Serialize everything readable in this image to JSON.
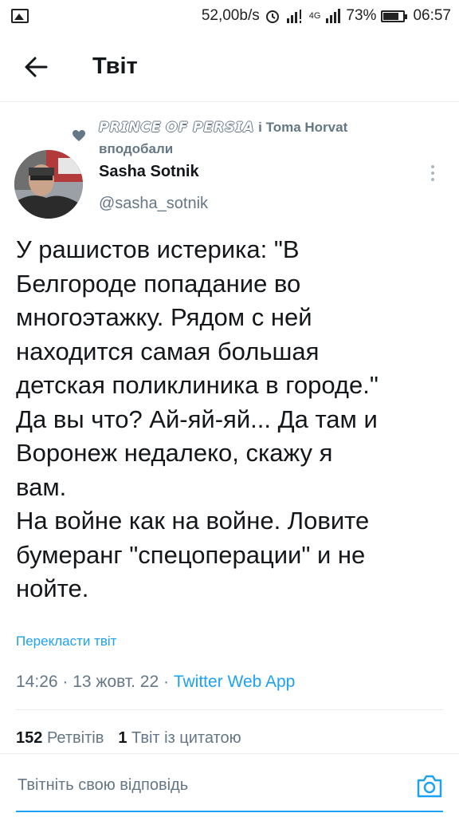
{
  "status_bar": {
    "net_speed": "52,00b/s",
    "network": "4G",
    "battery": "73%",
    "time": "06:57"
  },
  "header": {
    "title": "Твіт"
  },
  "liked_by": {
    "name1": "𝙋𝙍𝙄𝙉𝘾𝙀 𝙊𝙁 𝙋𝙀𝙍𝙎𝙄𝘼",
    "joiner": "і",
    "name2": "Toma Horvat",
    "suffix": "вподобали"
  },
  "tweet": {
    "author_name": "Sasha Sotnik",
    "author_handle": "@sasha_sotnik",
    "text": "У рашистов истерика: \"В\nБелгороде попадание во\nмногоэтажку. Рядом с ней\nнаходится самая большая\nдетская поликлиника в городе.\"\nДа вы что? Ай-яй-яй... Да там и\nВоронеж недалеко, скажу я\nвам.\nНа войне как на войне. Ловите\nбумеранг \"спецоперации\" и не\nнойте.",
    "translate_label": "Перекласти твіт",
    "time": "14:26",
    "date": "13 жовт. 22",
    "source": "Twitter Web App"
  },
  "stats": {
    "retweets_count": "152",
    "retweets_label": "Ретвітів",
    "quotes_count": "1",
    "quotes_label": "Твіт із цитатою"
  },
  "reply": {
    "placeholder": "Твітніть свою відповідь"
  },
  "colors": {
    "accent": "#1da1f2",
    "secondary_text": "#657786",
    "divider": "#e6ecf0"
  },
  "icons": [
    "image-icon",
    "alarm-icon",
    "signal-icon",
    "battery-icon",
    "back-arrow-icon",
    "heart-icon",
    "more-vertical-icon",
    "camera-icon"
  ]
}
